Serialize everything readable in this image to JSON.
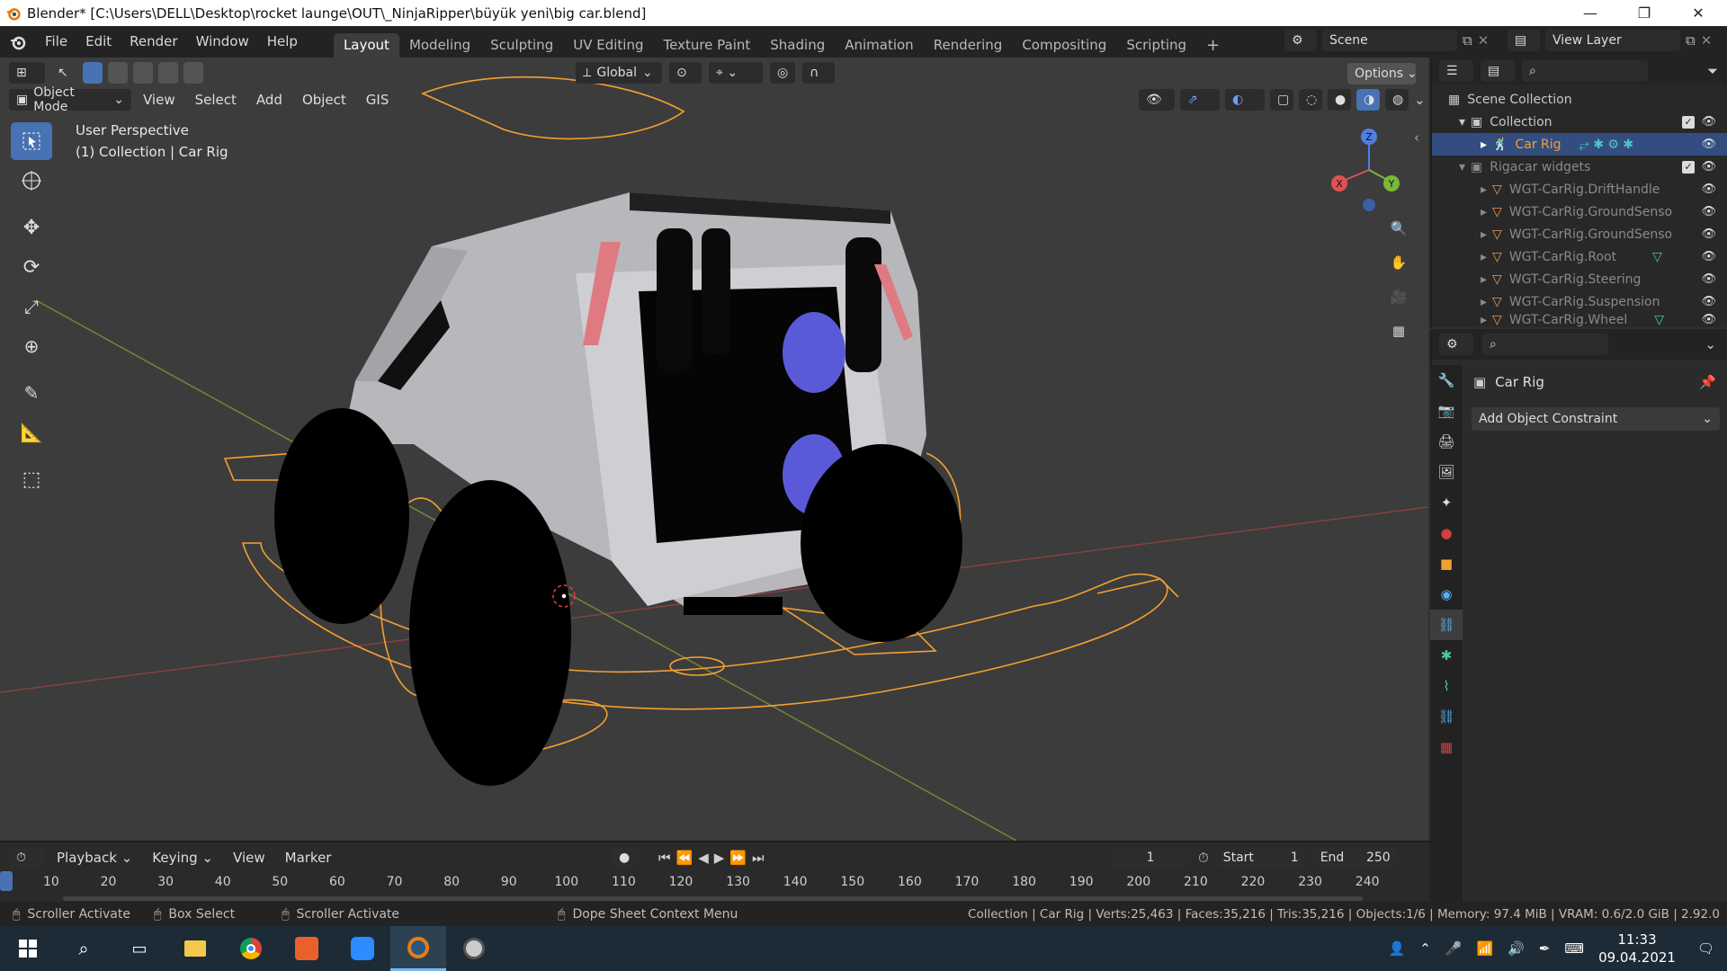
{
  "window": {
    "title": "Blender* [C:\\Users\\DELL\\Desktop\\rocket launge\\OUT\\_NinjaRipper\\büyük yeni\\big car.blend]",
    "controls": [
      "minimize-icon",
      "restore-icon",
      "close-icon"
    ]
  },
  "menubar": {
    "items": [
      "File",
      "Edit",
      "Render",
      "Window",
      "Help"
    ],
    "workspaces": [
      "Layout",
      "Modeling",
      "Sculpting",
      "UV Editing",
      "Texture Paint",
      "Shading",
      "Animation",
      "Rendering",
      "Compositing",
      "Scripting"
    ],
    "active_workspace": "Layout",
    "add_tab": "+",
    "scene_label": "Scene",
    "view_layer_label": "View Layer"
  },
  "viewport": {
    "transform_orientation": "Global",
    "options_label": "Options",
    "mode": "Object Mode",
    "menus": [
      "View",
      "Select",
      "Add",
      "Object",
      "GIS"
    ],
    "perspective_label": "User Perspective",
    "collection_label": "(1) Collection | Car Rig",
    "gizmo_axes": {
      "x": "X",
      "y": "Y",
      "z": "Z"
    }
  },
  "outliner": {
    "search_placeholder": "",
    "rows": [
      {
        "label": "Scene Collection",
        "level": 0
      },
      {
        "label": "Collection",
        "level": 1
      },
      {
        "label": "Car Rig",
        "level": 2,
        "selected": true
      },
      {
        "label": "Rigacar widgets",
        "level": 1,
        "dim": true
      },
      {
        "label": "WGT-CarRig.DriftHandle",
        "level": 2,
        "dim": true
      },
      {
        "label": "WGT-CarRig.GroundSenso",
        "level": 2,
        "dim": true
      },
      {
        "label": "WGT-CarRig.GroundSenso",
        "level": 2,
        "dim": true
      },
      {
        "label": "WGT-CarRig.Root",
        "level": 2,
        "dim": true
      },
      {
        "label": "WGT-CarRig.Steering",
        "level": 2,
        "dim": true
      },
      {
        "label": "WGT-CarRig.Suspension",
        "level": 2,
        "dim": true
      },
      {
        "label": "WGT-CarRig.Wheel",
        "level": 2,
        "dim": true
      }
    ]
  },
  "properties": {
    "object_name": "Car Rig",
    "add_constraint_label": "Add Object Constraint"
  },
  "timeline": {
    "menus": [
      "Playback",
      "Keying",
      "View",
      "Marker"
    ],
    "current_frame": "1",
    "start_label": "Start",
    "start_value": "1",
    "end_label": "End",
    "end_value": "250",
    "ticks": [
      "10",
      "20",
      "30",
      "40",
      "50",
      "60",
      "70",
      "80",
      "90",
      "100",
      "110",
      "120",
      "130",
      "140",
      "150",
      "160",
      "170",
      "180",
      "190",
      "200",
      "210",
      "220",
      "230",
      "240"
    ]
  },
  "statusbar": {
    "hint1": "Scroller Activate",
    "hint2": "Box Select",
    "hint3": "Scroller Activate",
    "hint4": "Dope Sheet Context Menu",
    "stats": "Collection | Car Rig | Verts:25,463 | Faces:35,216 | Tris:35,216 | Objects:1/6 | Memory: 97.4 MiB | VRAM: 0.6/2.0 GiB | 2.92.0"
  },
  "taskbar": {
    "time": "11:33",
    "date": "09.04.2021"
  },
  "colors": {
    "accent": "#4772b3",
    "selection_orange": "#f5a030",
    "viewport_bg": "#3a3a3a"
  }
}
